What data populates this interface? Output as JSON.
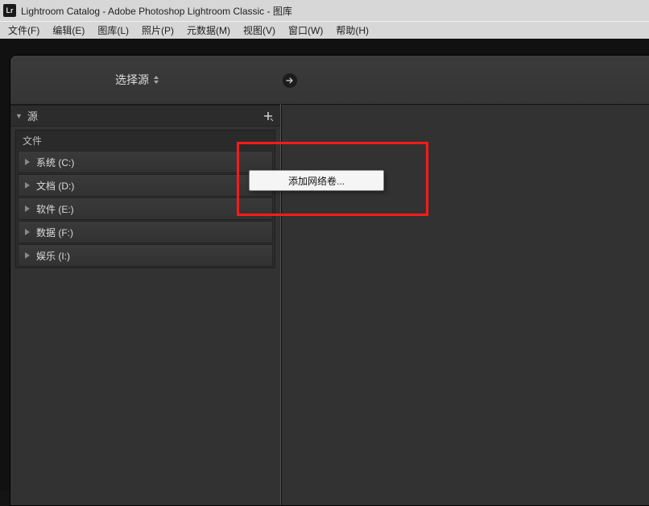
{
  "titlebar": {
    "app_icon": "Lr",
    "title": "Lightroom Catalog - Adobe Photoshop Lightroom Classic - 图库"
  },
  "menubar": {
    "items": [
      "文件(F)",
      "编辑(E)",
      "图库(L)",
      "照片(P)",
      "元数据(M)",
      "视图(V)",
      "窗口(W)",
      "帮助(H)"
    ]
  },
  "top": {
    "select_source_label": "选择源"
  },
  "source": {
    "header": "源"
  },
  "files": {
    "header": "文件",
    "drives": [
      "系统 (C:)",
      "文档 (D:)",
      "软件 (E:)",
      "数据 (F:)",
      "娱乐 (I:)"
    ]
  },
  "context_menu": {
    "item": "添加网络卷..."
  }
}
